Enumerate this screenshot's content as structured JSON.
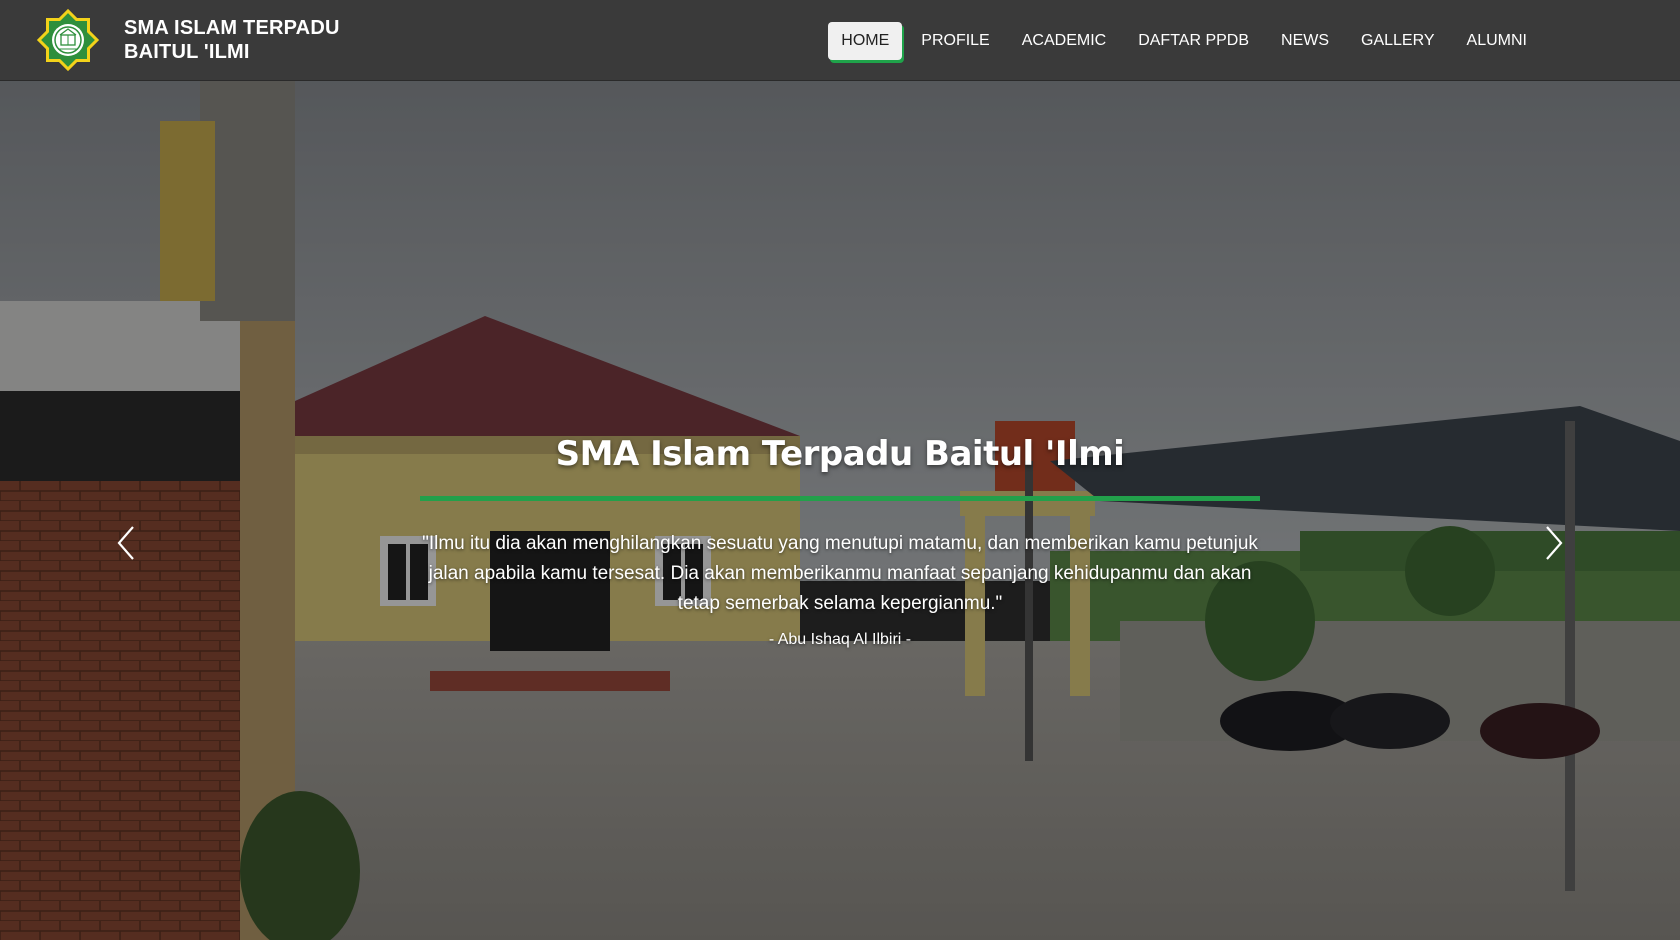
{
  "brand": {
    "line1": "SMA ISLAM TERPADU",
    "line2": "BAITUL 'ILMI",
    "logo_icon": "school-emblem-icon"
  },
  "nav": {
    "items": [
      {
        "label": "HOME",
        "active": true
      },
      {
        "label": "PROFILE",
        "active": false
      },
      {
        "label": "ACADEMIC",
        "active": false
      },
      {
        "label": "DAFTAR PPDB",
        "active": false
      },
      {
        "label": "NEWS",
        "active": false
      },
      {
        "label": "GALLERY",
        "active": false
      },
      {
        "label": "ALUMNI",
        "active": false
      }
    ]
  },
  "hero": {
    "title": "SMA Islam Terpadu Baitul 'Ilmi",
    "quote": "\"Ilmu itu dia akan menghilangkan sesuatu yang menutupi matamu, dan memberikan kamu petunjuk jalan apabila kamu tersesat. Dia akan memberikanmu manfaat sepanjang kehidupanmu dan akan tetap semerbak selama kepergianmu.\"",
    "author": "- Abu Ishaq Al Ilbiri -",
    "prev_icon": "chevron-left-icon",
    "next_icon": "chevron-right-icon"
  },
  "colors": {
    "navbar_bg": "#3a3a3a",
    "accent_green": "#22a04b",
    "active_nav_bg": "#f0f0f0"
  }
}
